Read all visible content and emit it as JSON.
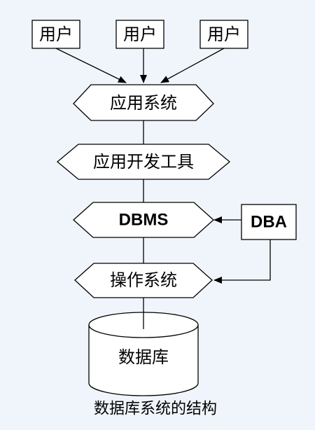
{
  "diagram": {
    "users": [
      "用户",
      "用户",
      "用户"
    ],
    "app_system": "应用系统",
    "dev_tools": "应用开发工具",
    "dbms": "DBMS",
    "dba": "DBA",
    "os": "操作系统",
    "database": "数据库"
  },
  "caption": "数据库系统的结构"
}
